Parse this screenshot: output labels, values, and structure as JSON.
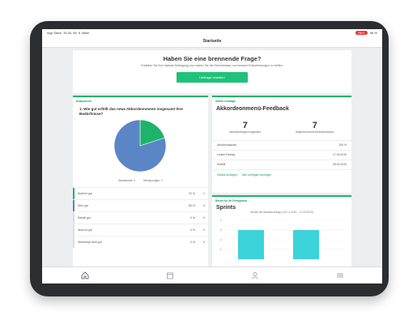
{
  "statusbar": {
    "left": "App Store, 15:34, Mi. 6. März",
    "rec": "REC",
    "battery": "96 %"
  },
  "navbar": {
    "title": "Startseite"
  },
  "hero": {
    "title": "Haben Sie eine brennende Frage?",
    "subtitle": "Erstellen Sie Ihre nächste Befragung und nutzen Sie die Erkenntnisse, um bessere Entscheidungen zu treffen.",
    "button": "Umfrage erstellen"
  },
  "analytics": {
    "label": "Analysieren",
    "question": "1. Wie gut erfüllt das neue Akkordeonmenü insgesamt Ihre Bedürfnisse?",
    "legend": [
      {
        "label": "Beantwortet: 5"
      },
      {
        "label": "Übersprungen: 2"
      }
    ],
    "pie": [
      {
        "label": "Äußerst gut",
        "value": 20,
        "color": "#1db36a"
      },
      {
        "label": "Sehr gut",
        "value": 80,
        "color": "#5b86c6"
      }
    ],
    "rows": [
      {
        "label": "Äußerst gut",
        "pct": "20 %",
        "count": "1",
        "color": "#1db36a"
      },
      {
        "label": "Sehr gut",
        "pct": "80 %",
        "count": "4",
        "color": "#5b86c6"
      },
      {
        "label": "Relativ gut",
        "pct": "0 %",
        "count": "0",
        "color": "#dddddd"
      },
      {
        "label": "Nicht so gut",
        "pct": "0 %",
        "count": "0",
        "color": "#dddddd"
      },
      {
        "label": "Überhaupt nicht gut",
        "pct": "0 %",
        "count": "0",
        "color": "#dddddd"
      }
    ]
  },
  "active": {
    "label": "Aktive Umfrage",
    "title": "Akkordeonmenü-Feedback",
    "stat1": {
      "num": "7",
      "cap": "Beantwortungen insgesamt"
    },
    "stat2": {
      "num": "7",
      "cap": "Abgeschlossene Beantwortungen"
    },
    "rows": [
      {
        "k": "Abschlussquote",
        "v": "100 %"
      },
      {
        "k": "Letzter Eintrag",
        "v": "17.03.2019"
      },
      {
        "k": "Erstellt",
        "v": "28.03.2019"
      }
    ],
    "link1": "Details anzeigen",
    "link2": "Alle Umfragen anzeigen"
  },
  "sprints": {
    "label": "Bereit für Ihr Feedgeben",
    "title": "Sprints",
    "subtitle": "Anzahl der Beantwortungen (10.11.2019 – 17.03.2019)",
    "color": "#3cd3db",
    "y_ticks": [
      "4",
      "3",
      "2",
      "1"
    ],
    "bars": [
      {
        "value": 3
      },
      {
        "value": 3
      }
    ]
  },
  "tabs": [
    "home-icon",
    "calendar-icon",
    "user-icon",
    "menu-icon"
  ]
}
